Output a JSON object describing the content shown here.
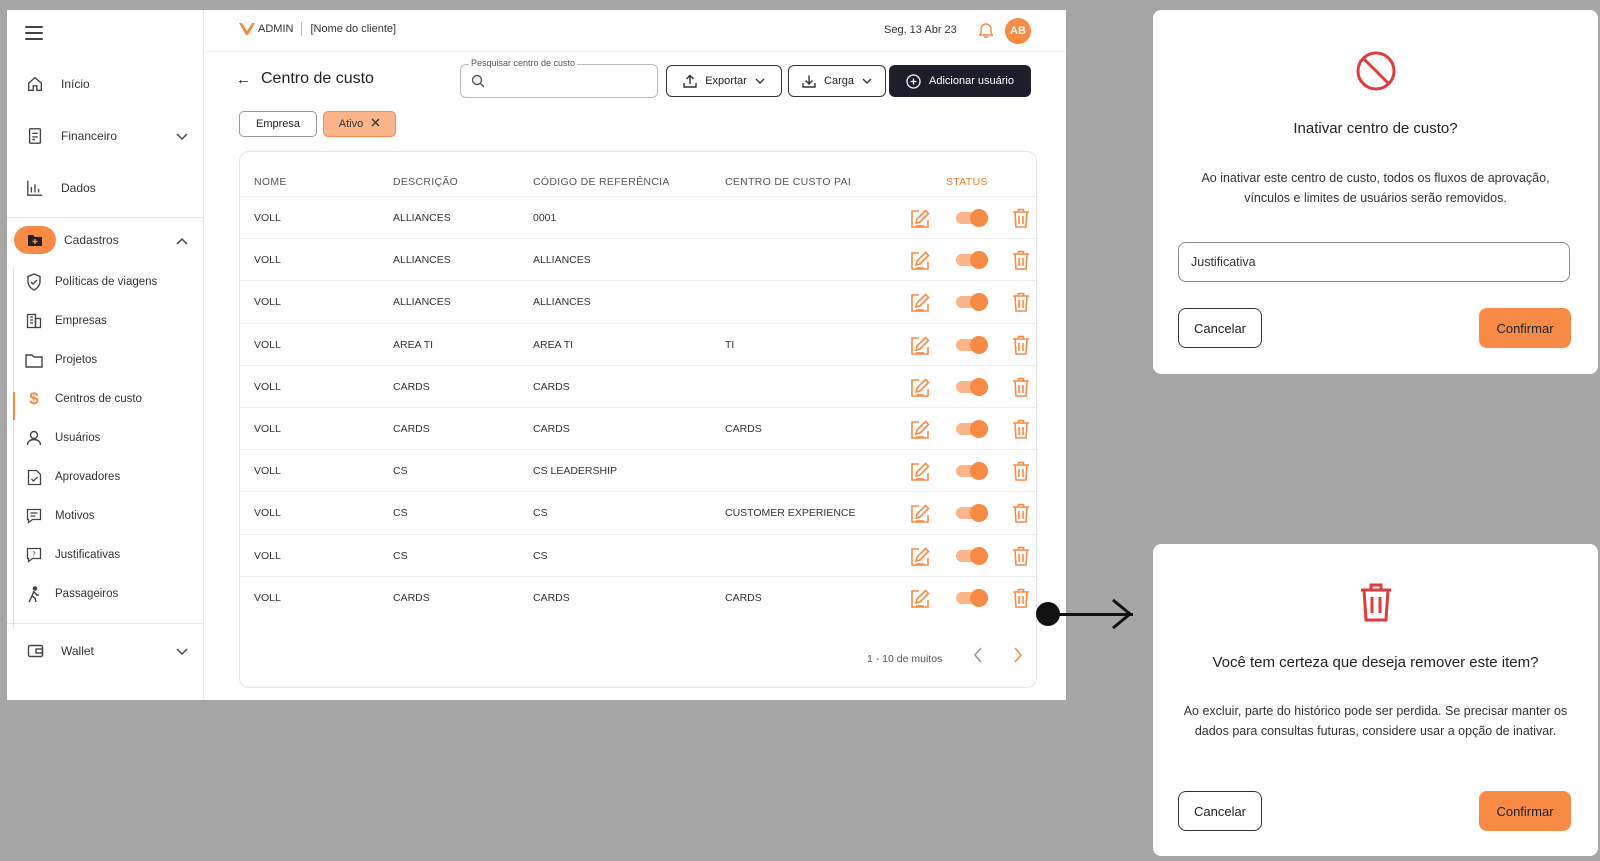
{
  "sidebar": {
    "items": [
      {
        "label": "Início"
      },
      {
        "label": "Financeiro"
      },
      {
        "label": "Dados"
      },
      {
        "label": "Cadastros"
      }
    ],
    "sub_items": [
      {
        "label": "Políticas de viagens"
      },
      {
        "label": "Empresas"
      },
      {
        "label": "Projetos"
      },
      {
        "label": "Centros de custo"
      },
      {
        "label": "Usuários"
      },
      {
        "label": "Aprovadores"
      },
      {
        "label": "Motivos"
      },
      {
        "label": "Justificativas"
      },
      {
        "label": "Passageiros"
      }
    ],
    "wallet": {
      "label": "Wallet"
    }
  },
  "header": {
    "brand": "ADMIN",
    "client": "[Nome do cliente]",
    "date": "Seg, 13 Abr 23",
    "avatar_initials": "AB"
  },
  "page": {
    "title": "Centro de custo",
    "search_legend": "Pesquisar centro de custo",
    "export_label": "Exportar",
    "load_label": "Carga",
    "add_label": "Adicionar usuário",
    "filters": {
      "empresa": "Empresa",
      "ativo": "Ativo"
    }
  },
  "table": {
    "headers": {
      "nome": "NOME",
      "descricao": "DESCRIÇÃO",
      "codigo": "CÓDIGO DE REFERÊNCIA",
      "pai": "CENTRO DE CUSTO PAI",
      "status": "STATUS"
    },
    "rows": [
      {
        "nome": "VOLL",
        "descricao": "ALLIANCES",
        "codigo": "0001",
        "pai": ""
      },
      {
        "nome": "VOLL",
        "descricao": "ALLIANCES",
        "codigo": "ALLIANCES",
        "pai": ""
      },
      {
        "nome": "VOLL",
        "descricao": "ALLIANCES",
        "codigo": "ALLIANCES",
        "pai": ""
      },
      {
        "nome": "VOLL",
        "descricao": "AREA TI",
        "codigo": "AREA TI",
        "pai": "TI"
      },
      {
        "nome": "VOLL",
        "descricao": "CARDS",
        "codigo": "CARDS",
        "pai": ""
      },
      {
        "nome": "VOLL",
        "descricao": "CARDS",
        "codigo": "CARDS",
        "pai": "CARDS"
      },
      {
        "nome": "VOLL",
        "descricao": "CS",
        "codigo": "CS LEADERSHIP",
        "pai": ""
      },
      {
        "nome": "VOLL",
        "descricao": "CS",
        "codigo": "CS",
        "pai": "CUSTOMER EXPERIENCE"
      },
      {
        "nome": "VOLL",
        "descricao": "CS",
        "codigo": "CS",
        "pai": ""
      },
      {
        "nome": "VOLL",
        "descricao": "CARDS",
        "codigo": "CARDS",
        "pai": "CARDS"
      }
    ],
    "pagination": "1 - 10 de muitos"
  },
  "modal_inactivate": {
    "title": "Inativar centro de custo?",
    "text": "Ao inativar este centro de custo, todos os fluxos de aprovação, vínculos e limites de usuários serão removidos.",
    "input_placeholder": "Justificativa",
    "cancel": "Cancelar",
    "confirm": "Confirmar"
  },
  "modal_remove": {
    "title": "Você tem certeza que deseja remover este item?",
    "text": "Ao excluir, parte do histórico pode ser perdida. Se precisar manter os dados para consultas futuras, considere usar a opção de inativar.",
    "cancel": "Cancelar",
    "confirm": "Confirmar"
  },
  "colors": {
    "accent": "#f78b45",
    "danger": "#e03a3a",
    "dark": "#1e1e2a"
  }
}
